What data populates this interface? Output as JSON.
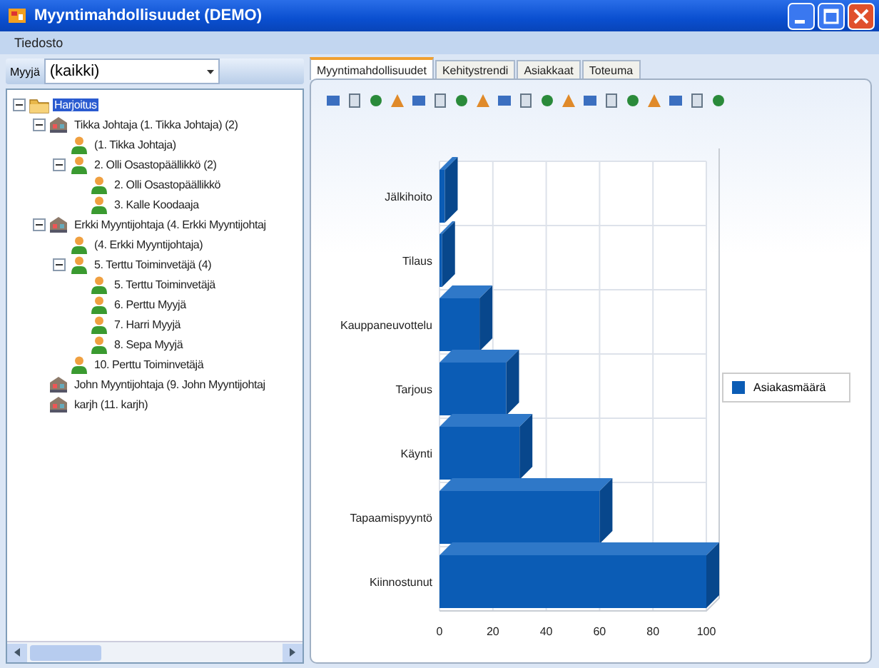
{
  "window": {
    "title": "Myyntimahdollisuudet (DEMO)"
  },
  "menu": [
    "Tiedosto"
  ],
  "filter": {
    "label": "Myyjä",
    "value": "(kaikki)"
  },
  "tree": {
    "items": [
      {
        "label": "Harjoitus",
        "kind": "folder",
        "selected": true,
        "expanded": true,
        "children": [
          {
            "label": "Tikka Johtaja (1. Tikka Johtaja) (2)",
            "kind": "office",
            "selected": false,
            "expanded": true,
            "children": [
              {
                "label": "(1. Tikka Johtaja)",
                "kind": "person",
                "selected": false
              },
              {
                "label": "2. Olli Osastopäällikkö (2)",
                "kind": "person",
                "selected": false,
                "expanded": true,
                "children": [
                  {
                    "label": "2. Olli Osastopäällikkö",
                    "kind": "person",
                    "selected": false
                  },
                  {
                    "label": "3. Kalle Koodaaja",
                    "kind": "person",
                    "selected": false
                  }
                ]
              }
            ]
          },
          {
            "label": "Erkki Myyntijohtaja (4. Erkki Myyntijohtaj",
            "kind": "office",
            "selected": false,
            "expanded": true,
            "children": [
              {
                "label": "(4. Erkki Myyntijohtaja)",
                "kind": "person",
                "selected": false
              },
              {
                "label": "5. Terttu Toiminvetäjä (4)",
                "kind": "person",
                "selected": false,
                "expanded": true,
                "children": [
                  {
                    "label": "5. Terttu Toiminvetäjä",
                    "kind": "person",
                    "selected": false
                  },
                  {
                    "label": "6. Perttu Myyjä",
                    "kind": "person",
                    "selected": false
                  },
                  {
                    "label": "7. Harri Myyjä",
                    "kind": "person",
                    "selected": false
                  },
                  {
                    "label": "8. Sepa Myyjä",
                    "kind": "person",
                    "selected": false
                  }
                ]
              },
              {
                "label": "10. Perttu Toiminvetäjä",
                "kind": "person",
                "selected": false
              }
            ]
          },
          {
            "label": "John Myyntijohtaja (9. John Myyntijohtaj",
            "kind": "office",
            "selected": false
          },
          {
            "label": "karjh (11. karjh)",
            "kind": "office",
            "selected": false
          }
        ]
      }
    ]
  },
  "tabs": [
    {
      "label": "Myyntimahdollisuudet",
      "selected": true
    },
    {
      "label": "Kehitystrendi",
      "selected": false
    },
    {
      "label": "Asiakkaat",
      "selected": false
    },
    {
      "label": "Toteuma",
      "selected": false
    }
  ],
  "chart_data": {
    "type": "bar",
    "orientation": "horizontal",
    "categories": [
      "Jälkihoito",
      "Tilaus",
      "Kauppaneuvottelu",
      "Tarjous",
      "Käynti",
      "Tapaamispyyntö",
      "Kiinnostunut"
    ],
    "series": [
      {
        "name": "Asiakasmäärä",
        "color": "#0b5cb5",
        "values": [
          2,
          1,
          15,
          25,
          30,
          60,
          100
        ]
      }
    ],
    "xlim": [
      0,
      100
    ],
    "xticks": [
      0,
      20,
      40,
      60,
      80,
      100
    ],
    "grid": true
  }
}
